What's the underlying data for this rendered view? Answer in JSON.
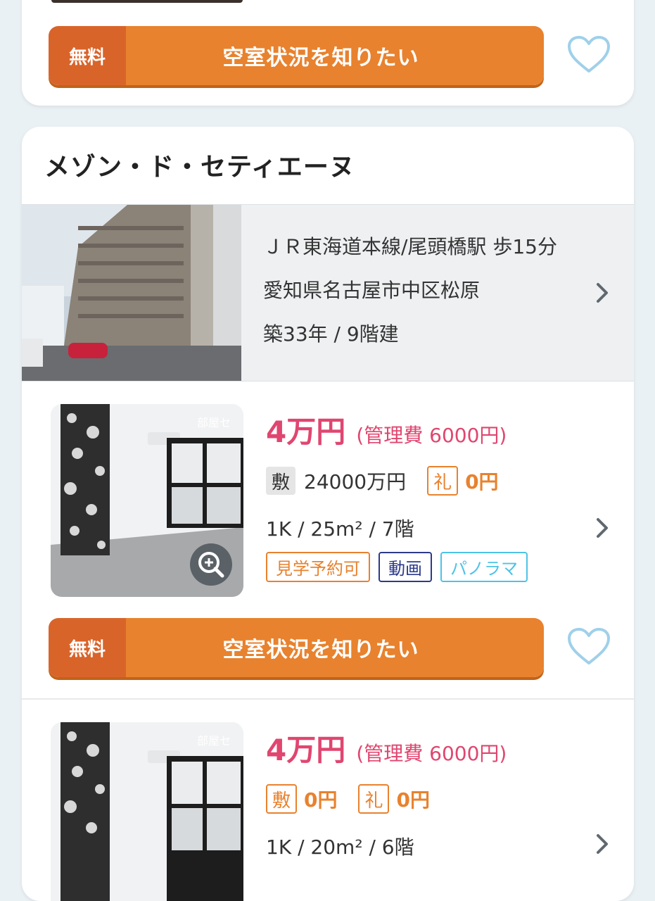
{
  "top_card": {
    "cta": {
      "free_label": "無料",
      "label": "空室状況を知りたい"
    },
    "favorite_icon": "heart-outline-icon"
  },
  "property": {
    "name": "メゾン・ド・セティエーヌ",
    "access": "ＪＲ東海道本線/尾頭橋駅 歩15分",
    "address": "愛知県名古屋市中区松原",
    "building": "築33年 / 9階建"
  },
  "rooms": [
    {
      "rent": "4万円",
      "management": "(管理費 6000円)",
      "deposit_label": "敷",
      "deposit": "24000万円",
      "key_money_label": "礼",
      "key_money": "0円",
      "spec": "1K / 25m² / 7階",
      "tags": [
        "見学予約可",
        "動画",
        "パノラマ"
      ],
      "cta": {
        "free_label": "無料",
        "label": "空室状況を知りたい"
      }
    },
    {
      "rent": "4万円",
      "management": "(管理費 6000円)",
      "deposit_label": "敷",
      "deposit": "0円",
      "key_money_label": "礼",
      "key_money": "0円",
      "spec": "1K / 20m² / 6階"
    }
  ],
  "photo_watermark": "部屋セ",
  "colors": {
    "accent_orange": "#e8822e",
    "cta_free_bg": "#d9642a",
    "price_pink": "#e0466f",
    "heart_blue": "#9fd0ea",
    "tag_navy": "#2d3a8a",
    "tag_cyan": "#4ec3e6"
  }
}
